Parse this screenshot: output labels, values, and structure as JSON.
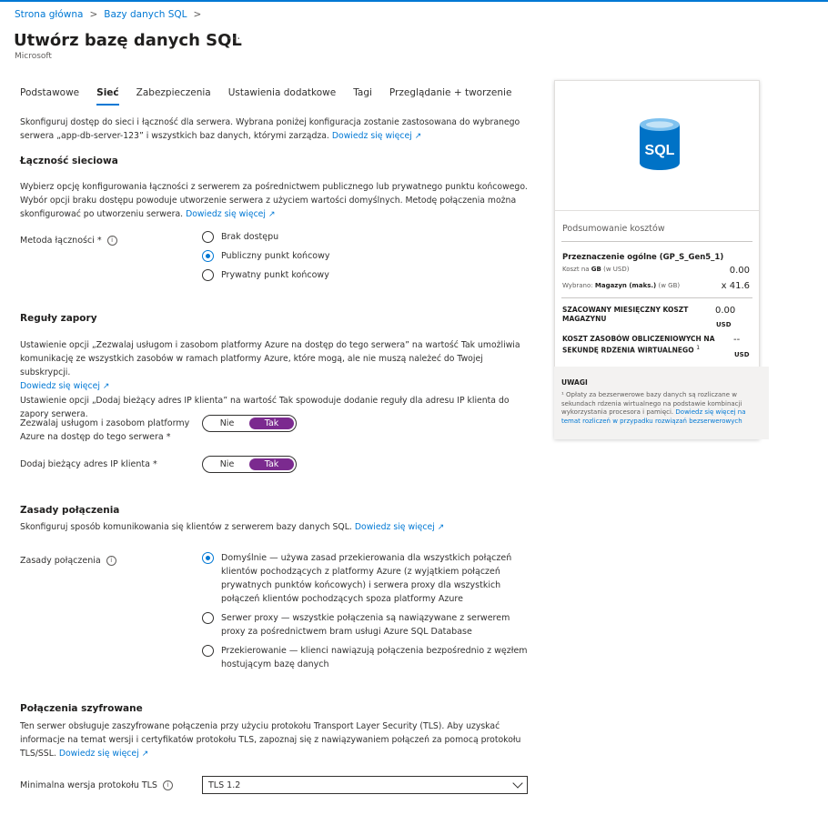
{
  "breadcrumb": [
    "Strona główna",
    "Bazy danych SQL"
  ],
  "page": {
    "title": "Utwórz bazę danych SQL",
    "more": "···",
    "subtitle": "Microsoft"
  },
  "tabs": [
    "Podstawowe",
    "Sieć",
    "Zabezpieczenia",
    "Ustawienia dodatkowe",
    "Tagi",
    "Przeglądanie + tworzenie"
  ],
  "active_tab": "Sieć",
  "intro": {
    "text": "Skonfiguruj dostęp do sieci i łączność dla serwera. Wybrana poniżej konfiguracja zostanie zastosowana do wybranego serwera „app-db-server-123” i wszystkich baz danych, którymi zarządza.",
    "link": "Dowiedz się więcej"
  },
  "connectivity": {
    "heading": "Łączność sieciowa",
    "text": "Wybierz opcję konfigurowania łączności z serwerem za pośrednictwem publicznego lub prywatnego punktu końcowego. Wybór opcji braku dostępu powoduje utworzenie serwera z użyciem wartości domyślnych. Metodę połączenia można skonfigurować po utworzeniu serwera.",
    "link": "Dowiedz się więcej",
    "label": "Metoda łączności *",
    "options": [
      "Brak dostępu",
      "Publiczny punkt końcowy",
      "Prywatny punkt końcowy"
    ],
    "selected_index": 1
  },
  "firewall": {
    "heading": "Reguły zapory",
    "text1": "Ustawienie opcji „Zezwalaj usługom i zasobom platformy Azure na dostęp do tego serwera” na wartość Tak umożliwia komunikację ze wszystkich zasobów w ramach platformy Azure, które mogą, ale nie muszą należeć do Twojej subskrypcji.",
    "link": "Dowiedz się więcej",
    "text2": "Ustawienie opcji „Dodaj bieżący adres IP klienta” na wartość Tak spowoduje dodanie reguły dla adresu IP klienta do zapory serwera.",
    "allow_azure_label_line1": "Zezwalaj usługom i zasobom platformy",
    "allow_azure_label_line2": "Azure na dostęp do tego serwera *",
    "add_ip_label": "Dodaj bieżący adres IP klienta *",
    "no": "Nie",
    "yes": "Tak",
    "allow_azure_value": "Tak",
    "add_ip_value": "Tak"
  },
  "policy": {
    "heading": "Zasady połączenia",
    "text": "Skonfiguruj sposób komunikowania się klientów z serwerem bazy danych SQL.",
    "link": "Dowiedz się więcej",
    "label": "Zasady połączenia",
    "options": [
      "Domyślnie — używa zasad przekierowania dla wszystkich połączeń klientów pochodzących z platformy Azure (z wyjątkiem połączeń prywatnych punktów końcowych) i serwera proxy dla wszystkich połączeń klientów pochodzących spoza platformy Azure",
      "Serwer proxy — wszystkie połączenia są nawiązywane z serwerem proxy za pośrednictwem bram usługi Azure SQL Database",
      "Przekierowanie — klienci nawiązują połączenia bezpośrednio z węzłem hostującym bazę danych"
    ],
    "selected_index": 0
  },
  "encrypted": {
    "heading": "Połączenia szyfrowane",
    "text": "Ten serwer obsługuje zaszyfrowane połączenia przy użyciu protokołu Transport Layer Security (TLS). Aby uzyskać informacje na temat wersji i certyfikatów protokołu TLS, zapoznaj się z nawiązywaniem połączeń za pomocą protokołu TLS/SSL.",
    "link": "Dowiedz się więcej",
    "tls_label": "Minimalna wersja protokołu TLS",
    "tls_value": "TLS 1.2"
  },
  "cost": {
    "icon_text": "SQL",
    "heading": "Podsumowanie kosztów",
    "tier": "Przeznaczenie ogólne (GP_S_Gen5_1)",
    "cost_per_gb_prefix": "Koszt na",
    "cost_per_gb_bold": "GB",
    "cost_per_gb_suffix": "(w USD)",
    "cost_per_gb_value": "0.00",
    "storage_prefix": "Wybrano:",
    "storage_bold": "Magazyn (maks.)",
    "storage_suffix": "(w GB)",
    "storage_value": "x 41.6",
    "monthly_label_1": "SZACOWANY MIESIĘCZNY KOSZT",
    "monthly_label_2": "MAGAZYNU",
    "monthly_value": "0.00",
    "monthly_currency": "USD",
    "compute_label_1": "KOSZT ZASOBÓW OBLICZENIOWYCH NA",
    "compute_label_2": "SEKUNDĘ RDZENIA WIRTUALNEGO",
    "compute_sup": "1",
    "compute_value": "--",
    "compute_currency": "USD",
    "notes_heading": "UWAGI",
    "notes_text": "¹ Opłaty za bezserwerowe bazy danych są rozliczane w sekundach rdzenia wirtualnego na podstawie kombinacji wykorzystania procesora i pamięci.",
    "notes_link": "Dowiedz się więcej na temat rozliczeń w przypadku rozwiązań bezserwerowych"
  },
  "colors": {
    "accent": "#0078d4",
    "toggle_on": "#7b2a8f"
  }
}
